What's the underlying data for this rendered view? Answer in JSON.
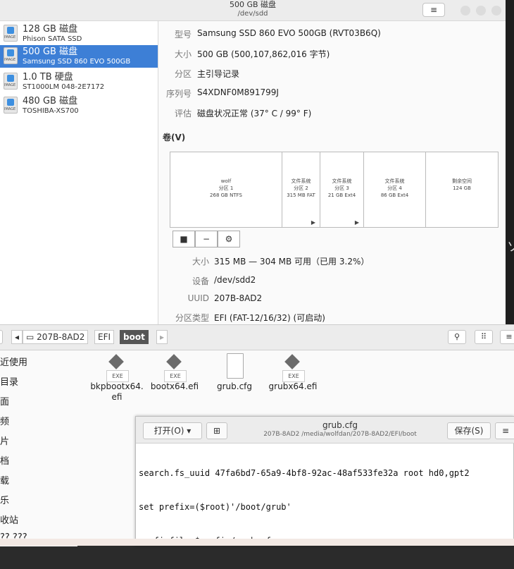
{
  "disks": {
    "title": "500 GB 磁盘",
    "subtitle": "/dev/sdd",
    "menu_icon": "hamburger-icon",
    "list": [
      {
        "name": "128 GB 磁盘",
        "model": "Phison SATA SSD"
      },
      {
        "name": "500 GB 磁盘",
        "model": "Samsung SSD 860 EVO 500GB"
      },
      {
        "name": "1.0 TB 硬盘",
        "model": "ST1000LM 048-2E7172"
      },
      {
        "name": "480 GB 磁盘",
        "model": "TOSHIBA-XS700"
      }
    ],
    "info": {
      "model_label": "型号",
      "model_value": "Samsung SSD 860 EVO 500GB (RVT03B6Q)",
      "size_label": "大小",
      "size_value": "500 GB (500,107,862,016 字节)",
      "partition_label": "分区",
      "partition_value": "主引导记录",
      "serial_label": "序列号",
      "serial_value": "S4XDNF0M891799J",
      "assessment_label": "评估",
      "assessment_value": "磁盘状况正常 (37° C / 99° F)"
    },
    "volumes_title": "卷(V)",
    "segments": [
      {
        "l1": "wolf",
        "l2": "分区 1",
        "l3": "268 GB NTFS",
        "arrow": ""
      },
      {
        "l1": "文件系统",
        "l2": "分区 2",
        "l3": "315 MB FAT",
        "arrow": "▶"
      },
      {
        "l1": "文件系统",
        "l2": "分区 3",
        "l3": "21 GB Ext4",
        "arrow": "▶"
      },
      {
        "l1": "文件系统",
        "l2": "分区 4",
        "l3": "86 GB Ext4",
        "arrow": ""
      },
      {
        "l1": "剩余空间",
        "l2": "124 GB",
        "l3": "",
        "arrow": ""
      }
    ],
    "vol_buttons": {
      "stop": "■",
      "minus": "−",
      "gear": "⚙"
    },
    "partition_info": {
      "size_label": "大小",
      "size_value": "315 MB — 304 MB 可用（已用 3.2%）",
      "device_label": "设备",
      "device_value": "/dev/sdd2",
      "uuid_label": "UUID",
      "uuid_value": "207B-8AD2",
      "type_label": "分区类型",
      "type_value": "EFI (FAT-12/16/32) (可启动)"
    },
    "right_glyph": "ソ"
  },
  "files": {
    "breadcrumbs": [
      "207B-8AD2",
      "EFI",
      "boot"
    ],
    "sidebar": [
      "近使用",
      "目录",
      "面",
      "频",
      "片",
      "档",
      "载",
      "乐",
      "收站",
      "?? ???"
    ],
    "items": [
      {
        "name": "bkpbootx64.efi",
        "type": "exe"
      },
      {
        "name": "bootx64.efi",
        "type": "exe"
      },
      {
        "name": "grub.cfg",
        "type": "doc"
      },
      {
        "name": "grubx64.efi",
        "type": "exe"
      }
    ],
    "exe_label": "EXE",
    "search_icon": "⚲",
    "view_icon": "⠿",
    "menu_icon": "≡"
  },
  "gedit": {
    "open_label": "打开(O) ▾",
    "pin_icon": "⊞",
    "title": "grub.cfg",
    "path": "207B-8AD2 /media/wolfdan/207B-8AD2/EFI/boot",
    "save_label": "保存(S)",
    "menu_icon": "≡",
    "lines": [
      "search.fs_uuid 47fa6bd7-65a9-4bf8-92ac-48af533fe32a root hd0,gpt2",
      "set prefix=($root)'/boot/grub'",
      "configfile $prefix/grub.cfg"
    ]
  }
}
